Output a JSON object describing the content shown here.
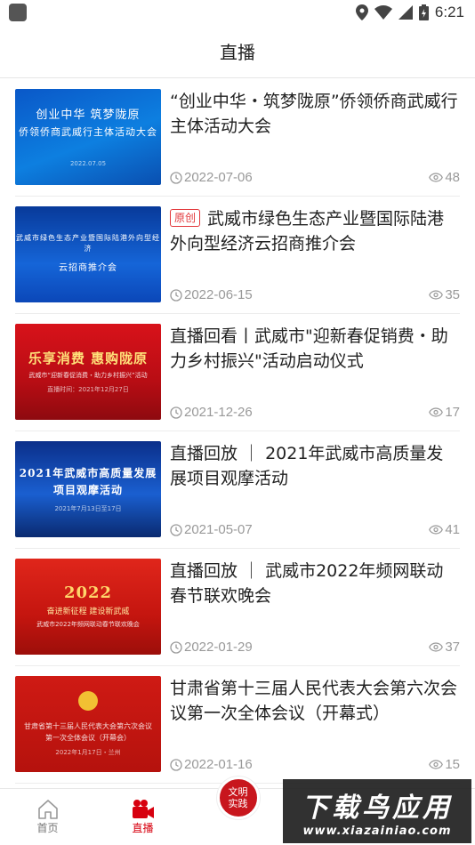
{
  "status": {
    "time": "6:21"
  },
  "header": {
    "title": "直播"
  },
  "items": [
    {
      "title": "“创业中华・筑梦陇原”侨领侨商武威行主体活动大会",
      "badge": "",
      "date": "2022-07-06",
      "views": "48",
      "thumb": {
        "line1": "创业中华 筑梦陇原",
        "line2": "侨领侨商武威行主体活动大会",
        "line3": "",
        "line4": "2022.07.05"
      }
    },
    {
      "title": "武威市绿色生态产业暨国际陆港外向型经济云招商推介会",
      "badge": "原创",
      "date": "2022-06-15",
      "views": "35",
      "thumb": {
        "line1": "武威市绿色生态产业暨国际陆港外向型经济",
        "line2": "云招商推介会",
        "line3": "",
        "line4": ""
      }
    },
    {
      "title": "直播回看丨武威市\"迎新春促销费・助力乡村振兴\"活动启动仪式",
      "badge": "",
      "date": "2021-12-26",
      "views": "17",
      "thumb": {
        "line1": "乐享消费 惠购陇原",
        "line2": "武威市“迎新春促消费・助力乡村振兴”活动",
        "line3": "直播时间：2021年12月27日",
        "line4": ""
      }
    },
    {
      "title": "直播回放 ｜ 2021年武威市高质量发展项目观摩活动",
      "badge": "",
      "date": "2021-05-07",
      "views": "41",
      "thumb": {
        "line1": "2021年武威市高质量发展",
        "line2": "项目观摩活动",
        "line3": "2021年7月13日至17日",
        "line4": ""
      }
    },
    {
      "title": "直播回放 ｜ 武威市2022年频网联动春节联欢晚会",
      "badge": "",
      "date": "2022-01-29",
      "views": "37",
      "thumb": {
        "line1": "2022",
        "line2": "奋进新征程 建设新武威",
        "line3": "武威市2022年频网联动春节联欢晚会",
        "line4": ""
      }
    },
    {
      "title": "甘肃省第十三届人民代表大会第六次会议第一次全体会议（开幕式）",
      "badge": "",
      "date": "2022-01-16",
      "views": "15",
      "thumb": {
        "line1": "甘肃省第十三届人民代表大会第六次会议",
        "line2": "第一次全体会议（开幕会）",
        "line3": "2022年1月17日・兰州",
        "line4": ""
      }
    }
  ],
  "nav": {
    "home": "首页",
    "live": "直播",
    "center_line1": "文明",
    "center_line2": "实践"
  },
  "watermark": {
    "line1": "下载鸟应用",
    "line2": "www.xiazainiao.com"
  },
  "colors": {
    "accent": "#d7000f",
    "blue_thumb": "#1464c8",
    "red_thumb": "#c8161d"
  }
}
